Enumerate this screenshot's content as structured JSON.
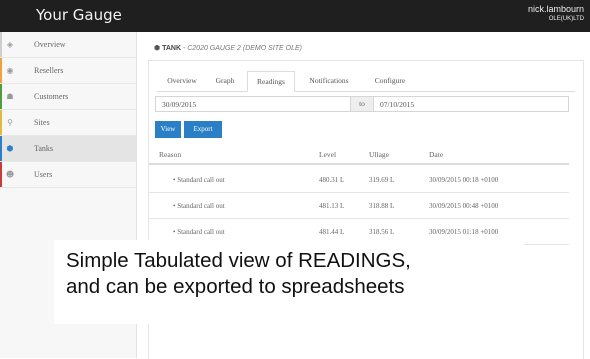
{
  "header": {
    "brand": "Your Gauge",
    "user_name": "nick.lambourn",
    "org": "OLE(UK)LTD"
  },
  "sidebar": {
    "items": [
      {
        "label": "Overview",
        "icon": "dashboard-icon",
        "glyph": "◈",
        "accent": "#cfcfcf",
        "active": false
      },
      {
        "label": "Resellers",
        "icon": "globe-icon",
        "glyph": "◉",
        "accent": "#f0a13a",
        "active": false
      },
      {
        "label": "Customers",
        "icon": "users-icon",
        "glyph": "☗",
        "accent": "#4f9d3d",
        "active": false
      },
      {
        "label": "Sites",
        "icon": "map-marker-icon",
        "glyph": "⚲",
        "accent": "#e2b93b",
        "active": false
      },
      {
        "label": "Tanks",
        "icon": "shield-icon",
        "glyph": "⬢",
        "accent": "#2a7fc6",
        "active": true
      },
      {
        "label": "Users",
        "icon": "user-icon",
        "glyph": "☻",
        "accent": "#cc3b3b",
        "active": false
      }
    ]
  },
  "page_title": {
    "prefix": "TANK",
    "detail": "- C2020 GAUGE 2 (DEMO SITE OLE)"
  },
  "tabs": [
    "Overview",
    "Graph",
    "Readings",
    "Notifications",
    "Configure"
  ],
  "active_tab": "Readings",
  "date_range": {
    "from": "30/09/2015",
    "to_label": "to",
    "to": "07/10/2015"
  },
  "buttons": {
    "view": "View",
    "export": "Export"
  },
  "table": {
    "headers": [
      "Reason",
      "Level",
      "Ullage",
      "Date"
    ],
    "rows": [
      {
        "reason": "Standard call out",
        "level": "480.31 L",
        "ullage": "319.69 L",
        "date": "30/09/2015 00:18 +0100"
      },
      {
        "reason": "Standard call out",
        "level": "481.13 L",
        "ullage": "318.88 L",
        "date": "30/09/2015 00:48 +0100"
      },
      {
        "reason": "Standard call out",
        "level": "481.44 L",
        "ullage": "318.56 L",
        "date": "30/09/2015 01:18 +0100"
      }
    ]
  },
  "caption": {
    "line1": "Simple Tabulated view of READINGS,",
    "line2": "and can be exported to spreadsheets"
  },
  "colors": {
    "header_bg": "#1f1f1f",
    "primary": "#2a7fc6"
  }
}
